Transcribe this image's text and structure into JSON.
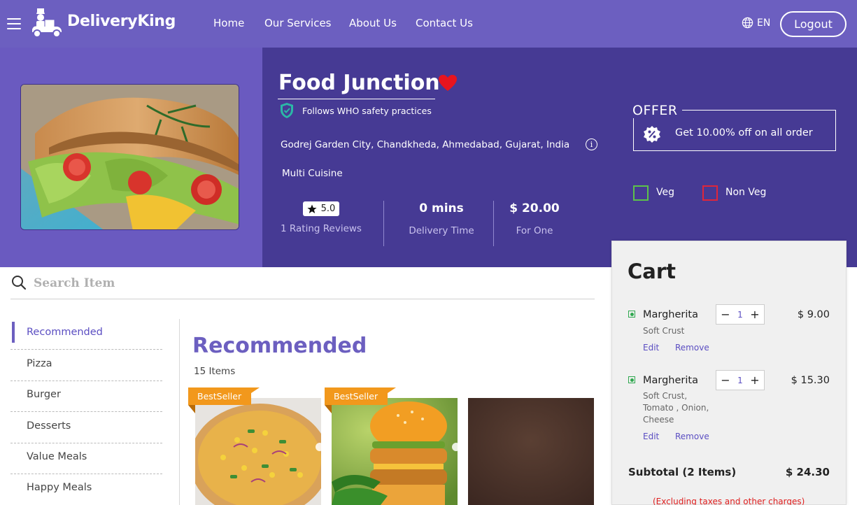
{
  "nav": {
    "brand": "DeliveryKing",
    "links": [
      "Home",
      "Our Services",
      "About Us",
      "Contact Us"
    ],
    "language": "EN",
    "logout_label": "Logout"
  },
  "restaurant": {
    "name": "Food Junction",
    "safety": "Follows WHO safety practices",
    "address": "Godrej Garden City, Chandkheda, Ahmedabad, Gujarat, India",
    "cuisine": "Multi Cuisine",
    "rating": "5.0",
    "rating_label": "1 Rating Reviews",
    "delivery_time": "0 mins",
    "delivery_label": "Delivery Time",
    "price_for_one": "$ 20.00",
    "price_label": "For One"
  },
  "offer": {
    "title": "OFFER",
    "text": "Get 10.00% off on all order"
  },
  "filters": {
    "veg": "Veg",
    "nonveg": "Non Veg",
    "veg_color": "#5cc24a",
    "nonveg_color": "#e0263a"
  },
  "search": {
    "placeholder": "Search Item"
  },
  "categories": [
    "Recommended",
    "Pizza",
    "Burger",
    "Desserts",
    "Value Meals",
    "Happy Meals"
  ],
  "main": {
    "title": "Recommended",
    "count": "15 Items",
    "badge": "BestSeller"
  },
  "cart": {
    "title": "Cart",
    "items": [
      {
        "name": "Margherita",
        "desc": "Soft Crust",
        "qty": "1",
        "price": "$ 9.00"
      },
      {
        "name": "Margherita",
        "desc": "Soft Crust, Tomato , Onion, Cheese",
        "qty": "1",
        "price": "$ 15.30"
      }
    ],
    "edit_label": "Edit",
    "remove_label": "Remove",
    "subtotal_label": "Subtotal (2 Items)",
    "subtotal_value": "$ 24.30",
    "tax_note": "(Excluding taxes and other charges)"
  },
  "colors": {
    "primary": "#6c5fc0",
    "hero_dark": "#463a94",
    "ribbon": "#f2981c"
  }
}
